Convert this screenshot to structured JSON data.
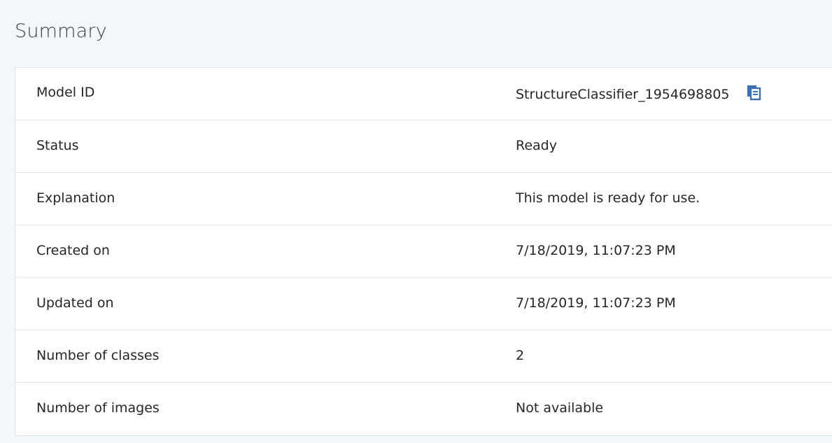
{
  "page": {
    "title": "Summary"
  },
  "summary": {
    "rows": [
      {
        "label": "Model ID",
        "value": "StructureClassifier_1954698805"
      },
      {
        "label": "Status",
        "value": "Ready"
      },
      {
        "label": "Explanation",
        "value": "This model is ready for use."
      },
      {
        "label": "Created on",
        "value": "7/18/2019, 11:07:23 PM"
      },
      {
        "label": "Updated on",
        "value": "7/18/2019, 11:07:23 PM"
      },
      {
        "label": "Number of classes",
        "value": "2"
      },
      {
        "label": "Number of images",
        "value": "Not available"
      }
    ],
    "copy_icon": "copy-icon"
  },
  "colors": {
    "background": "#f3f6fa",
    "card": "#ffffff",
    "border": "#dfe3e6",
    "icon": "#3d70b2"
  }
}
